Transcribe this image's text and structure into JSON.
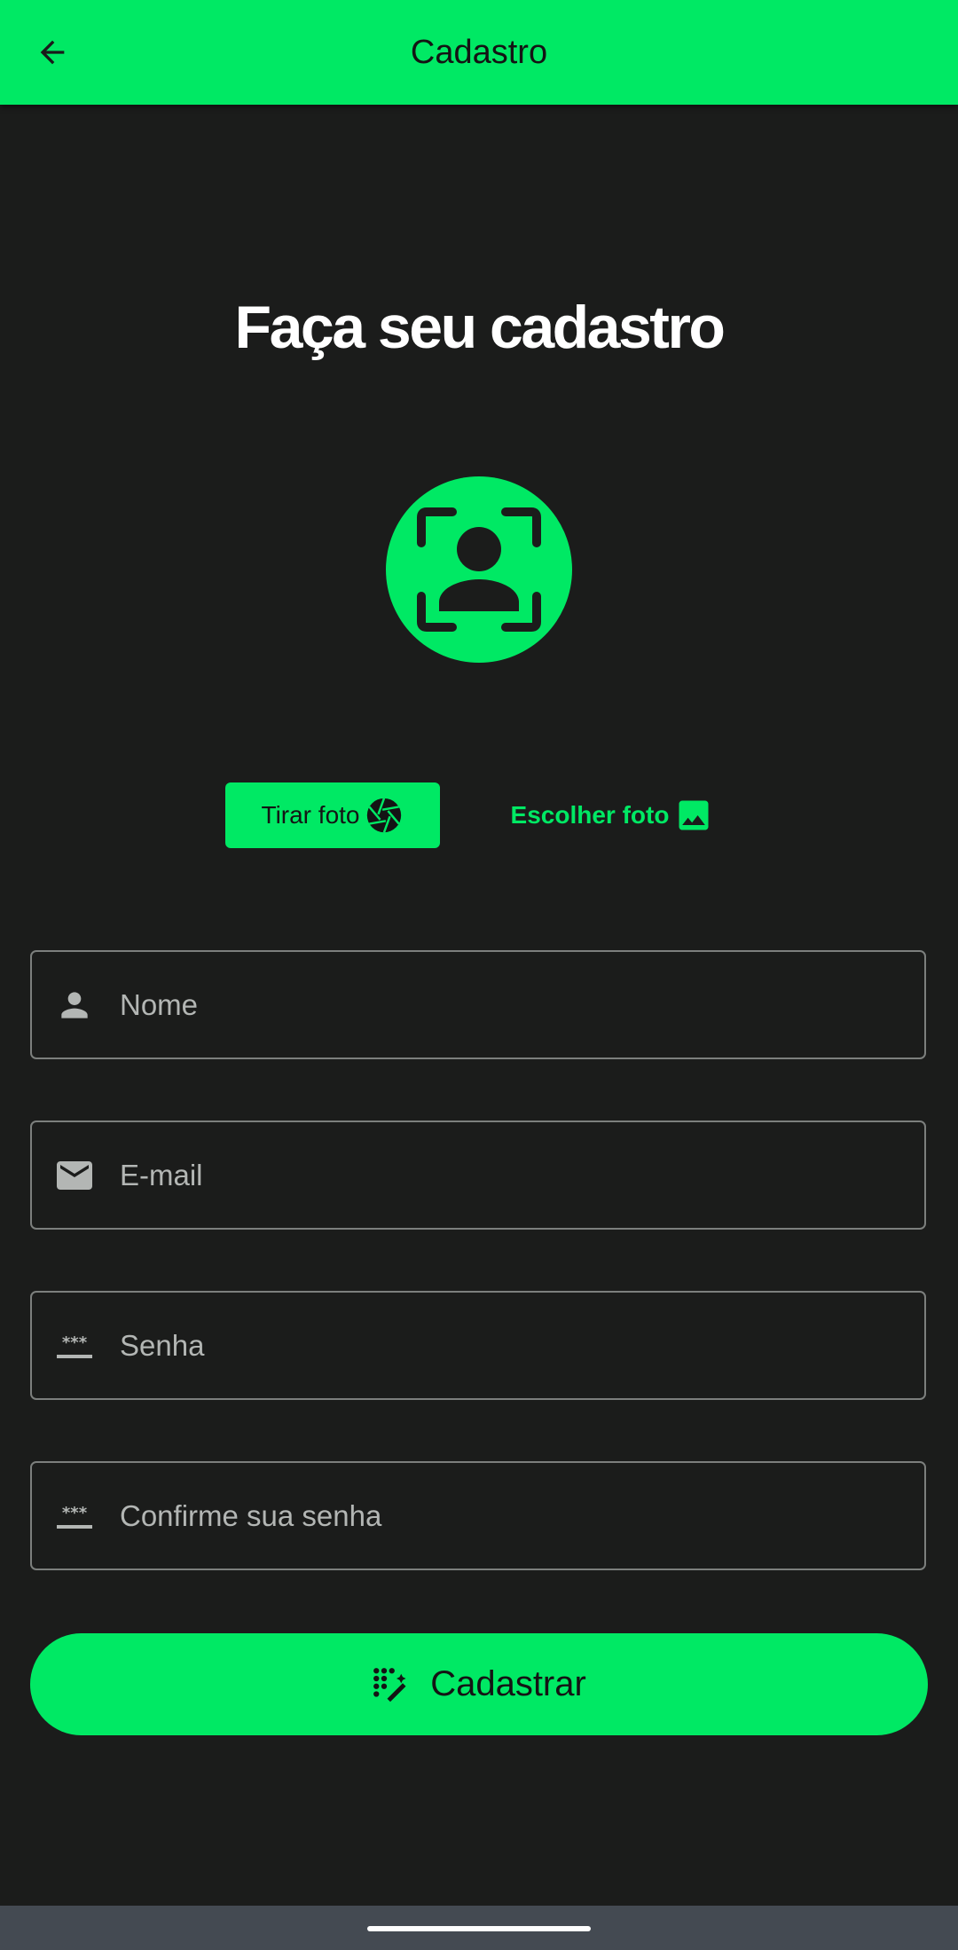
{
  "appbar": {
    "title": "Cadastro",
    "back_icon": "arrow-back-icon",
    "background": "#00e964"
  },
  "heading": "Faça seu cadastro",
  "avatar": {
    "icon": "face-scan-person-icon"
  },
  "photo_actions": {
    "take_label": "Tirar foto",
    "take_icon": "camera-shutter-icon",
    "choose_label": "Escolher foto",
    "choose_icon": "image-icon"
  },
  "form": {
    "name": {
      "placeholder": "Nome",
      "value": "",
      "icon": "person-icon"
    },
    "email": {
      "placeholder": "E-mail",
      "value": "",
      "icon": "mail-icon"
    },
    "password": {
      "placeholder": "Senha",
      "value": "",
      "icon": "password-icon"
    },
    "confirm_password": {
      "placeholder": "Confirme sua senha",
      "value": "",
      "icon": "password-icon"
    }
  },
  "submit": {
    "label": "Cadastrar",
    "icon": "magic-wand-icon"
  },
  "colors": {
    "accent": "#00e964",
    "background": "#1b1c1b",
    "field_border": "#7c7f7d"
  }
}
